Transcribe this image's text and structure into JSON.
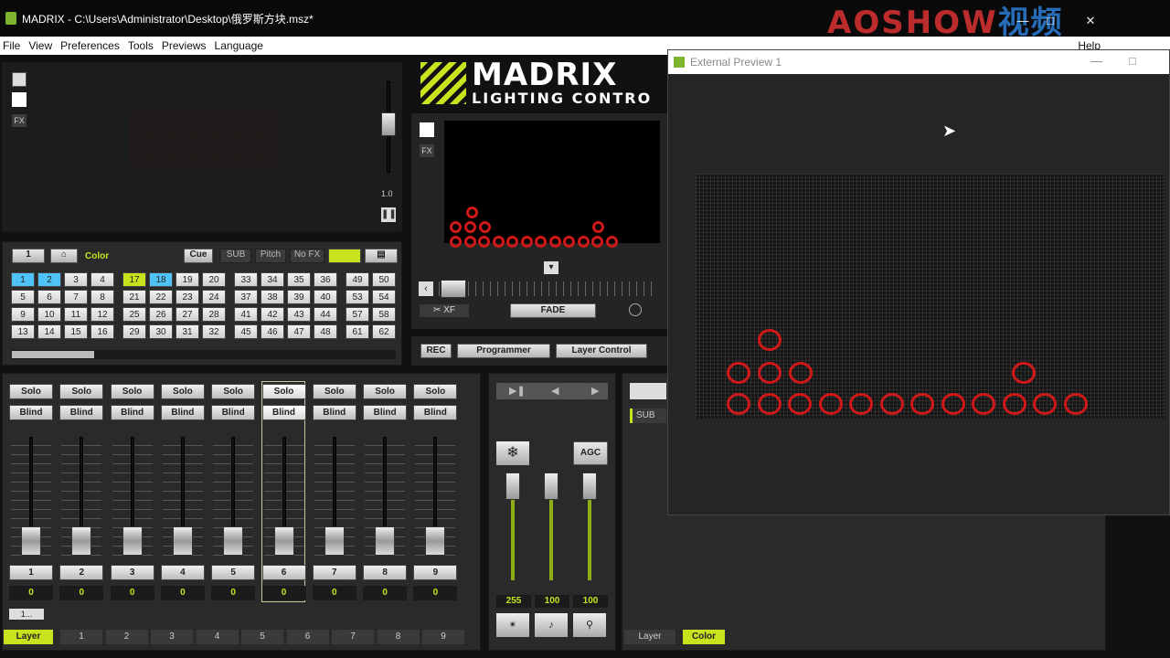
{
  "window": {
    "title": "MADRIX - C:\\Users\\Administrator\\Desktop\\俄罗斯方块.msz*"
  },
  "watermark": {
    "text": "AOSHOW",
    "suffix": "视频"
  },
  "menu": {
    "items": [
      "File",
      "View",
      "Preferences",
      "Tools",
      "Previews",
      "Language"
    ],
    "help": "Help"
  },
  "logo": {
    "brand": "MADRIX",
    "tagline": "LIGHTING CONTRO"
  },
  "left_preview": {
    "fx": "FX",
    "speed": "1.0"
  },
  "storage": {
    "page": "1",
    "place_label": "Color",
    "cue": "Cue",
    "sub": "SUB",
    "pitch": "Pitch",
    "nofx": "No FX",
    "blocks": [
      [
        "1",
        "2",
        "3",
        "4",
        "5",
        "6",
        "7",
        "8",
        "9",
        "10",
        "11",
        "12",
        "13",
        "14",
        "15",
        "16"
      ],
      [
        "17",
        "18",
        "19",
        "20",
        "21",
        "22",
        "23",
        "24",
        "25",
        "26",
        "27",
        "28",
        "29",
        "30",
        "31",
        "32"
      ],
      [
        "33",
        "34",
        "35",
        "36",
        "37",
        "38",
        "39",
        "40",
        "41",
        "42",
        "43",
        "44",
        "45",
        "46",
        "47",
        "48"
      ],
      [
        "49",
        "50",
        "53",
        "54",
        "57",
        "58",
        "61",
        "62"
      ]
    ]
  },
  "center": {
    "fx": "FX",
    "xf": "XF",
    "fade": "FADE",
    "rec": "REC",
    "programmer": "Programmer",
    "layer_control": "Layer Control"
  },
  "layers": {
    "solo": "Solo",
    "blind": "Blind",
    "channels": [
      "1",
      "2",
      "3",
      "4",
      "5",
      "6",
      "7",
      "8",
      "9"
    ],
    "values": [
      "0",
      "0",
      "0",
      "0",
      "0",
      "0",
      "0",
      "0",
      "0"
    ],
    "page_label": "1...",
    "bottom_label": "Layer",
    "bottom_tabs": [
      "1",
      "2",
      "3",
      "4",
      "5",
      "6",
      "7",
      "8",
      "9"
    ]
  },
  "master": {
    "agc": "AGC",
    "values": [
      "255",
      "100",
      "100"
    ]
  },
  "right": {
    "sub": "SUB",
    "layer": "Layer",
    "color": "Color"
  },
  "external": {
    "title": "External Preview 1"
  },
  "colors": {
    "accent": "#c8e21e",
    "selected_blue": "#4fc3f7",
    "led_red": "#d01818"
  }
}
